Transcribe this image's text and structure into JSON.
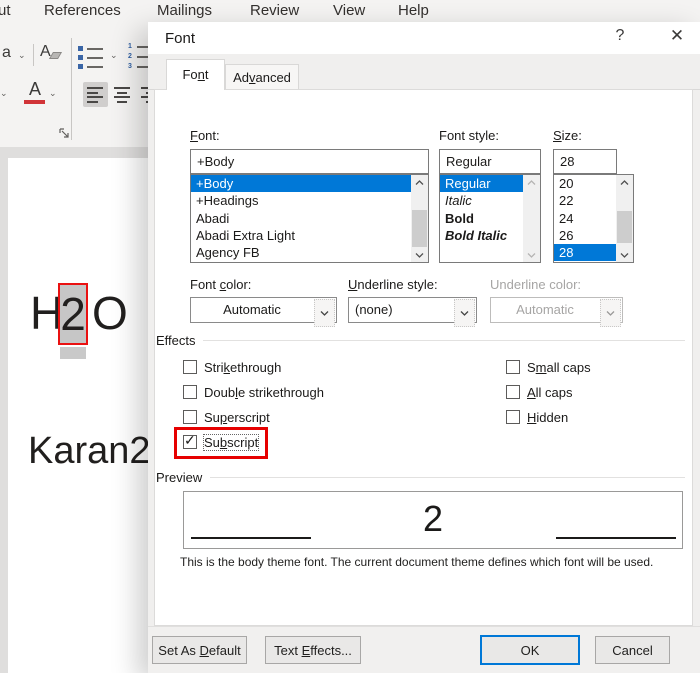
{
  "ribbon": {
    "menu_items": [
      "ut",
      "References",
      "Mailings",
      "Review",
      "View",
      "Help"
    ],
    "case_button_letter": "a",
    "clear_format_letter": "A",
    "font_color_letter": "A",
    "font_color_hex": "#d13438",
    "numbered_list_digits": [
      "1",
      "2",
      "3"
    ]
  },
  "document": {
    "heading_pre": "H",
    "heading_selected": "2",
    "heading_post": "O",
    "paragraph": "Karan2"
  },
  "dialog": {
    "title": "Font",
    "help_icon": "?",
    "close_icon": "✕",
    "tabs": [
      {
        "label": "Fo[n]t",
        "active": true
      },
      {
        "label": "Ad[v]anced",
        "active": false
      }
    ],
    "font": {
      "label": "[F]ont:",
      "value": "+Body",
      "items": [
        "+Body",
        "+Headings",
        "Abadi",
        "Abadi Extra Light",
        "Agency FB"
      ],
      "selected": "+Body"
    },
    "font_style": {
      "label": "Font style:",
      "value": "Regular",
      "items": [
        "Regular",
        "Italic",
        "Bold",
        "Bold Italic"
      ],
      "selected": "Regular"
    },
    "size": {
      "label": "[S]ize:",
      "value": "28",
      "items": [
        "20",
        "22",
        "24",
        "26",
        "28"
      ],
      "selected": "28"
    },
    "font_color": {
      "label": "Font [c]olor:",
      "value": "Automatic"
    },
    "underline_style": {
      "label": "[U]nderline style:",
      "value": "(none)"
    },
    "underline_color": {
      "label": "Underline color:",
      "value": "Automatic",
      "disabled": true
    },
    "effects": {
      "label": "Effects",
      "checkboxes": [
        {
          "label": "Stri[k]ethrough",
          "checked": false
        },
        {
          "label": "Doub[l]e strikethrough",
          "checked": false
        },
        {
          "label": "Su[p]erscript",
          "checked": false
        },
        {
          "label": "Su[b]script",
          "checked": true,
          "highlighted": true
        },
        {
          "label": "S[m]all caps",
          "checked": false
        },
        {
          "label": "[A]ll caps",
          "checked": false
        },
        {
          "label": "[H]idden",
          "checked": false
        }
      ]
    },
    "preview": {
      "label": "Preview",
      "sample": "2",
      "description": "This is the body theme font. The current document theme defines which font will be used."
    },
    "buttons": {
      "set_as_default": "Set As [D]efault",
      "text_effects": "Text [E]ffects...",
      "ok": "OK",
      "cancel": "Cancel"
    },
    "accent_color": "#0078d7",
    "annotation_color": "#e60000"
  }
}
